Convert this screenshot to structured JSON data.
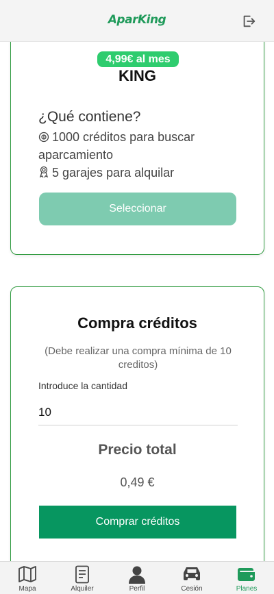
{
  "header": {
    "logo_text": "AparKing",
    "brand_color": "#1f9a5a",
    "logout_icon": "logout-icon"
  },
  "plan": {
    "price_badge": "4,99€ al mes",
    "name": "KING",
    "contains_title": "¿Qué contiene?",
    "features": [
      {
        "icon": "coin-icon",
        "text": "1000 créditos para buscar aparcamiento"
      },
      {
        "icon": "award-icon",
        "text": "5 garajes para alquilar"
      }
    ],
    "select_label": "Seleccionar"
  },
  "buy": {
    "title": "Compra créditos",
    "note": "(Debe realizar una compra mínima de 10 creditos)",
    "quantity_label": "Introduce la cantidad",
    "quantity_value": "10",
    "total_label": "Precio total",
    "total_value": "0,49 €",
    "buy_label": "Comprar créditos"
  },
  "tabs": [
    {
      "icon": "map-icon",
      "label": "Mapa"
    },
    {
      "icon": "document-icon",
      "label": "Alquiler"
    },
    {
      "icon": "user-icon",
      "label": "Perfil"
    },
    {
      "icon": "car-icon",
      "label": "Cesión"
    },
    {
      "icon": "wallet-icon",
      "label": "Planes",
      "active": true
    }
  ],
  "colors": {
    "accent": "#079660",
    "badge": "#2ecc6e",
    "select_button": "#7ecbb0",
    "card_border": "#2e9a3e"
  }
}
